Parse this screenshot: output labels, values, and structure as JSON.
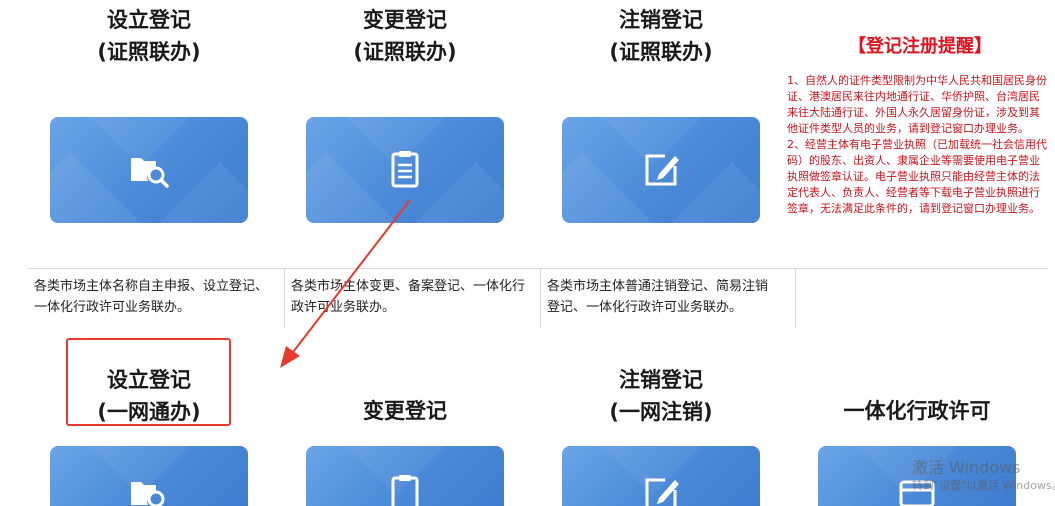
{
  "row1": [
    {
      "title1": "设立登记",
      "title2": "(证照联办)",
      "icon": "search-folder-icon",
      "desc": "各类市场主体名称自主申报、设立登记、一体化行政许可业务联办。"
    },
    {
      "title1": "变更登记",
      "title2": "(证照联办)",
      "icon": "clipboard-icon",
      "desc": "各类市场主体变更、备案登记、一体化行政许可业务联办。"
    },
    {
      "title1": "注销登记",
      "title2": "(证照联办)",
      "icon": "edit-icon",
      "desc": "各类市场主体普通注销登记、简易注销登记、一体化行政许可业务联办。"
    }
  ],
  "notice": {
    "title": "【登记注册提醒】",
    "p1": "1、自然人的证件类型限制为中华人民共和国居民身份证、港澳居民来往内地通行证、华侨护照、台湾居民来往大陆通行证、外国人永久居留身份证，涉及到其他证件类型人员的业务，请到登记窗口办理业务。",
    "p2": "2、经营主体有电子营业执照（已加载统一社会信用代码）的股东、出资人、隶属企业等需要使用电子营业执照做签章认证。电子营业执照只能由经营主体的法定代表人、负责人、经营者等下载电子营业执照进行签章，无法满足此条件的，请到登记窗口办理业务。"
  },
  "row2": [
    {
      "title1": "设立登记",
      "title2": "(一网通办)",
      "icon": "search-folder-icon"
    },
    {
      "title1": "变更登记",
      "icon": "clipboard-icon"
    },
    {
      "title1": "注销登记",
      "title2": "(一网注销)",
      "icon": "edit-icon"
    },
    {
      "title1": "一体化行政许可",
      "icon": "card-icon"
    }
  ],
  "watermark": {
    "line1": "激活 Windows",
    "line2": "转到\"设置\"以激活 Windows。"
  }
}
